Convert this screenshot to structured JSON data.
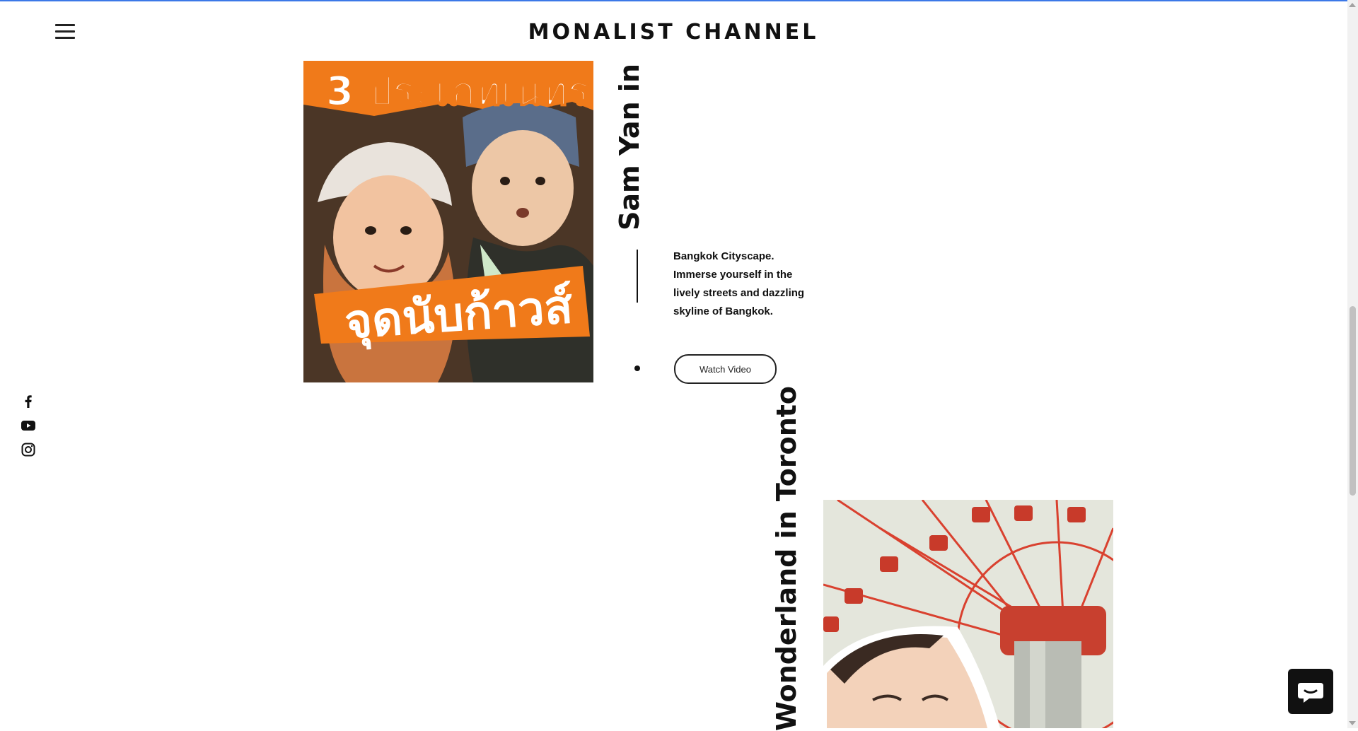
{
  "header": {
    "title": "MONALIST CHANNEL",
    "menu_icon": "hamburger-menu-icon"
  },
  "social": [
    {
      "name": "facebook",
      "icon": "facebook-icon"
    },
    {
      "name": "youtube",
      "icon": "youtube-icon"
    },
    {
      "name": "instagram",
      "icon": "instagram-icon"
    }
  ],
  "videos": [
    {
      "title": "Sam Yan in Th",
      "thumb_text_top": "3 ประเภทเนทรบ",
      "thumb_text_bottom": "จุดนับก้าวส์",
      "description": "Bangkok Cityscape. Immerse yourself in the lively streets and dazzling skyline of Bangkok.",
      "button_label": "Watch Video"
    },
    {
      "title": "Wonderland in Toronto"
    }
  ],
  "colors": {
    "accent_line": "#3b78e7",
    "thumb_orange": "#f07a1a",
    "ride_red": "#d9412f"
  },
  "chat_icon": "chat-bubble-icon"
}
